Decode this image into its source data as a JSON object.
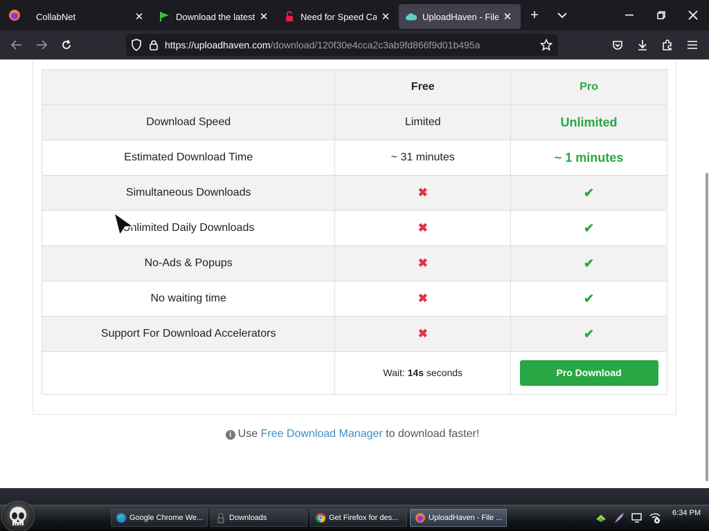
{
  "browser": {
    "tabs": [
      {
        "title": "CollabNet",
        "active": false
      },
      {
        "title": "Download the latest fre",
        "active": false
      },
      {
        "title": "Need for Speed Carbon",
        "active": false
      },
      {
        "title": "UploadHaven - File Sha",
        "active": true
      }
    ],
    "url": {
      "domain": "https://uploadhaven.com",
      "path": "/download/120f30e4cca2c3ab9fd866f9d01b495a"
    }
  },
  "comparison": {
    "header": {
      "free": "Free",
      "pro": "Pro"
    },
    "rows": [
      {
        "feature": "Download Speed",
        "free": "Limited",
        "pro": "Unlimited"
      },
      {
        "feature": "Estimated Download Time",
        "free": "~ 31 minutes",
        "pro": "~ 1 minutes"
      },
      {
        "feature": "Simultaneous Downloads",
        "free": "✖",
        "pro": "✔"
      },
      {
        "feature": "Unlimited Daily Downloads",
        "free": "✖",
        "pro": "✔"
      },
      {
        "feature": "No-Ads & Popups",
        "free": "✖",
        "pro": "✔"
      },
      {
        "feature": "No waiting time",
        "free": "✖",
        "pro": "✔"
      },
      {
        "feature": "Support For Download Accelerators",
        "free": "✖",
        "pro": "✔"
      }
    ],
    "wait": {
      "prefix": "Wait: ",
      "value": "14s",
      "suffix": " seconds"
    },
    "pro_button": "Pro Download"
  },
  "fdm": {
    "info_icon": "i",
    "prefix": "Use ",
    "link": "Free Download Manager",
    "suffix": " to download faster!"
  },
  "taskbar": {
    "items": [
      {
        "label": "Google Chrome We...",
        "icon": "edge-icon"
      },
      {
        "label": "Downloads",
        "icon": "folder-icon"
      },
      {
        "label": "Get Firefox for des...",
        "icon": "chrome-icon"
      },
      {
        "label": "UploadHaven - File ...",
        "icon": "firefox-icon"
      }
    ],
    "clock": "6:34 PM"
  },
  "colors": {
    "accent_green": "#28a745",
    "cross_red": "#dc3545",
    "link_blue": "#3d8ec4",
    "browser_dark": "#1c1b22"
  }
}
